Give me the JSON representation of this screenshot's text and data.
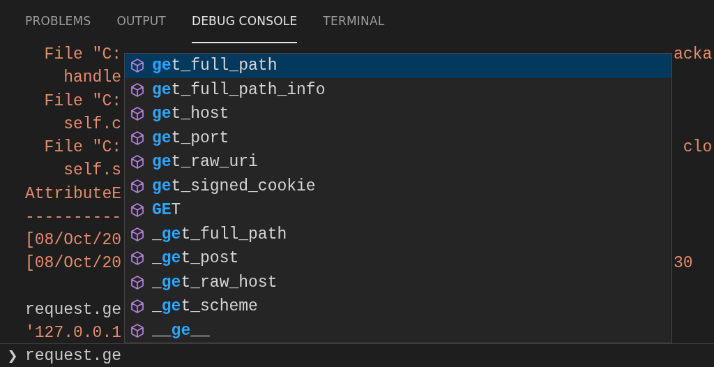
{
  "tabs": [
    {
      "label": "PROBLEMS",
      "selected": false
    },
    {
      "label": "OUTPUT",
      "selected": false
    },
    {
      "label": "DEBUG CONSOLE",
      "selected": true
    },
    {
      "label": "TERMINAL",
      "selected": false
    }
  ],
  "console_lines": [
    {
      "kind": "error",
      "text": "  File \"C:",
      "tail": "acka"
    },
    {
      "kind": "error",
      "text": "    handle"
    },
    {
      "kind": "error",
      "text": "  File \"C:"
    },
    {
      "kind": "error",
      "text": "    self.c"
    },
    {
      "kind": "error",
      "text": "  File \"C:",
      "tail": " clo"
    },
    {
      "kind": "error",
      "text": "    self.s"
    },
    {
      "kind": "error",
      "text": "AttributeE"
    },
    {
      "kind": "error",
      "text": "----------"
    },
    {
      "kind": "error",
      "text": "[08/Oct/20"
    },
    {
      "kind": "error",
      "text": "[08/Oct/20",
      "tail": "30"
    },
    {
      "kind": "blank"
    },
    {
      "kind": "input",
      "text": "request.ge"
    },
    {
      "kind": "error",
      "text": "'127.0.0.1"
    }
  ],
  "suggestions": [
    {
      "match": "ge",
      "rest": "t_full_path",
      "selected": true
    },
    {
      "match": "ge",
      "rest": "t_full_path_info",
      "selected": false
    },
    {
      "match": "ge",
      "rest": "t_host",
      "selected": false
    },
    {
      "match": "ge",
      "rest": "t_port",
      "selected": false
    },
    {
      "match": "ge",
      "rest": "t_raw_uri",
      "selected": false
    },
    {
      "match": "ge",
      "rest": "t_signed_cookie",
      "selected": false
    },
    {
      "match": "GE",
      "rest": "T",
      "selected": false
    },
    {
      "prefix": "_",
      "match": "ge",
      "rest": "t_full_path",
      "selected": false
    },
    {
      "prefix": "_",
      "match": "ge",
      "rest": "t_post",
      "selected": false
    },
    {
      "prefix": "_",
      "match": "ge",
      "rest": "t_raw_host",
      "selected": false
    },
    {
      "prefix": "_",
      "match": "ge",
      "rest": "t_scheme",
      "selected": false
    },
    {
      "prefix": "__",
      "match": "ge",
      "rest": "__",
      "selected": false
    }
  ],
  "input": {
    "prompt": "❯",
    "value": "request.ge"
  }
}
